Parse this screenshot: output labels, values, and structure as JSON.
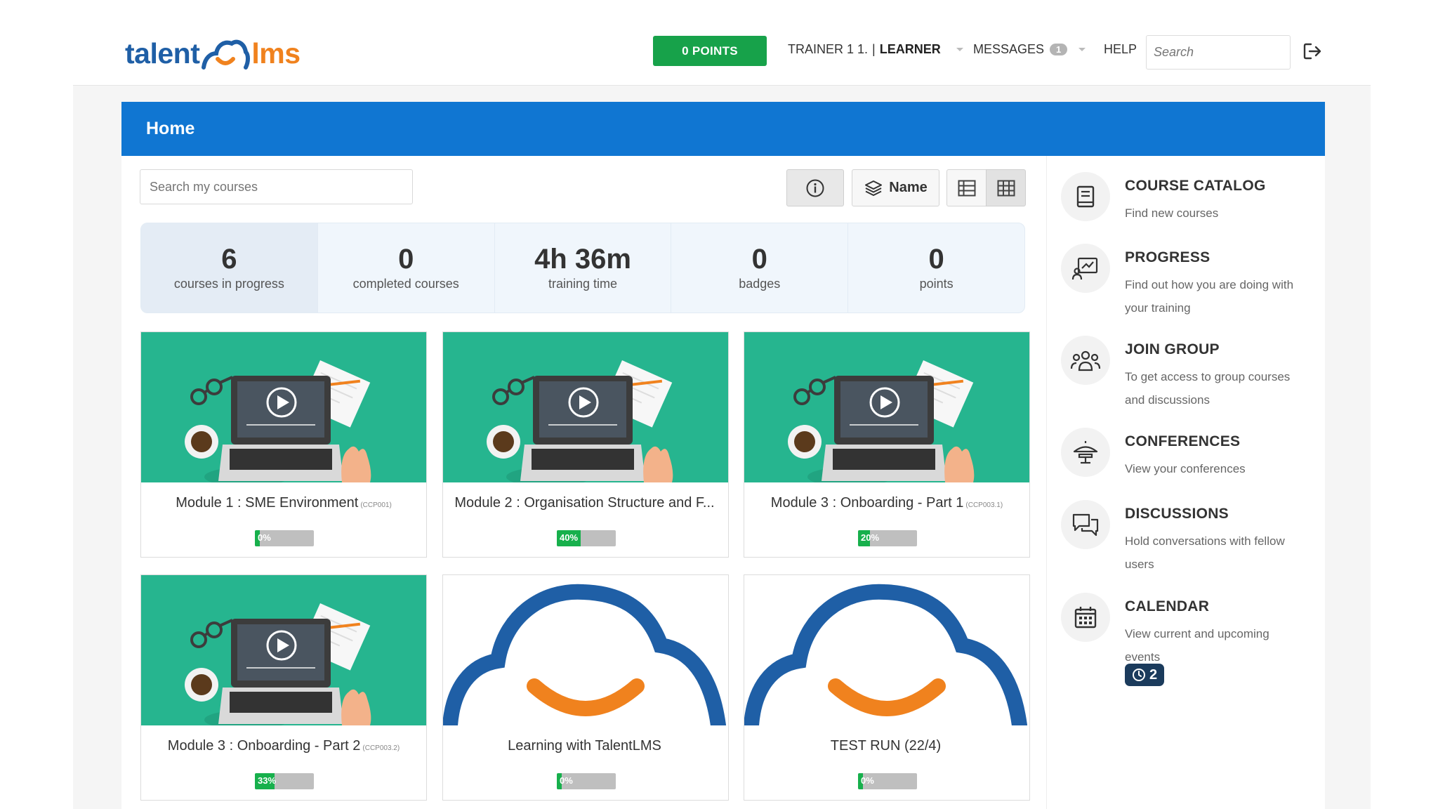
{
  "header": {
    "logo_left": "talent",
    "logo_right": "lms",
    "points_label": "0 POINTS",
    "user_name": "TRAINER 1 1.",
    "user_separator": "|",
    "user_role": "LEARNER",
    "messages_label": "MESSAGES",
    "messages_count": "1",
    "help_label": "HELP",
    "search_placeholder": "Search"
  },
  "page": {
    "title": "Home",
    "course_search_placeholder": "Search my courses",
    "sort_label": "Name"
  },
  "stats": [
    {
      "value": "6",
      "label": "courses in progress"
    },
    {
      "value": "0",
      "label": "completed courses"
    },
    {
      "value": "4h 36m",
      "label": "training time"
    },
    {
      "value": "0",
      "label": "badges"
    },
    {
      "value": "0",
      "label": "points"
    }
  ],
  "courses": [
    {
      "title": "Module 1 : SME Environment",
      "code": "(CCP001)",
      "progress": "0%",
      "progress_value": 0,
      "image": "laptop-illustration"
    },
    {
      "title": "Module 2 : Organisation Structure and F...",
      "code": "",
      "progress": "40%",
      "progress_value": 40,
      "image": "laptop-illustration"
    },
    {
      "title": "Module 3 : Onboarding - Part 1",
      "code": "(CCP003.1)",
      "progress": "20%",
      "progress_value": 20,
      "image": "laptop-illustration"
    },
    {
      "title": "Module 3 : Onboarding - Part 2",
      "code": "(CCP003.2)",
      "progress": "33%",
      "progress_value": 33,
      "image": "laptop-illustration"
    },
    {
      "title": "Learning with TalentLMS",
      "code": "",
      "progress": "0%",
      "progress_value": 0,
      "image": "talentlms-cloud"
    },
    {
      "title": "TEST RUN (22/4)",
      "code": "",
      "progress": "0%",
      "progress_value": 0,
      "image": "talentlms-cloud"
    }
  ],
  "sidebar": [
    {
      "title": "COURSE CATALOG",
      "desc": "Find new courses",
      "icon": "book-icon"
    },
    {
      "title": "PROGRESS",
      "desc": "Find out how you are doing with your training",
      "icon": "progress-chart-icon"
    },
    {
      "title": "JOIN GROUP",
      "desc": "To get access to group courses and discussions",
      "icon": "group-icon"
    },
    {
      "title": "CONFERENCES",
      "desc": "View your conferences",
      "icon": "conference-icon"
    },
    {
      "title": "DISCUSSIONS",
      "desc": "Hold conversations with fellow users",
      "icon": "chat-icon"
    },
    {
      "title": "CALENDAR",
      "desc": "View current and upcoming events",
      "icon": "calendar-icon",
      "badge": "2"
    }
  ],
  "colors": {
    "brand_blue": "#1076d2",
    "points_green": "#17a24a",
    "progress_green": "#17b04c",
    "card_teal": "#26b58f",
    "logo_orange": "#f0821e"
  }
}
